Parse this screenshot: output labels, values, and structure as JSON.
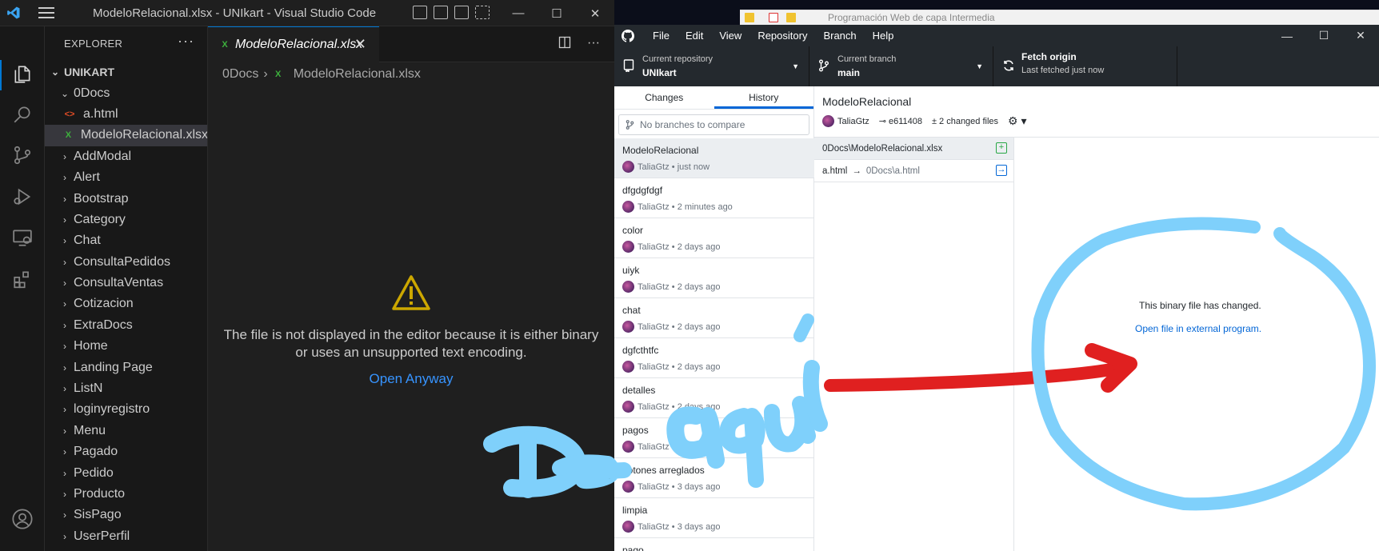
{
  "vscode": {
    "window_title": "ModeloRelacional.xlsx - UNIkart - Visual Studio Code",
    "explorer": {
      "header": "EXPLORER",
      "more": "···",
      "root": "UNIKART",
      "items": [
        {
          "label": "0Docs",
          "type": "folder-open"
        },
        {
          "label": "a.html",
          "type": "html"
        },
        {
          "label": "ModeloRelacional.xlsx",
          "type": "xlsx",
          "selected": true
        },
        {
          "label": "AddModal",
          "type": "folder"
        },
        {
          "label": "Alert",
          "type": "folder"
        },
        {
          "label": "Bootstrap",
          "type": "folder"
        },
        {
          "label": "Category",
          "type": "folder"
        },
        {
          "label": "Chat",
          "type": "folder"
        },
        {
          "label": "ConsultaPedidos",
          "type": "folder"
        },
        {
          "label": "ConsultaVentas",
          "type": "folder"
        },
        {
          "label": "Cotizacion",
          "type": "folder"
        },
        {
          "label": "ExtraDocs",
          "type": "folder"
        },
        {
          "label": "Home",
          "type": "folder"
        },
        {
          "label": "Landing Page",
          "type": "folder"
        },
        {
          "label": "ListN",
          "type": "folder"
        },
        {
          "label": "loginyregistro",
          "type": "folder"
        },
        {
          "label": "Menu",
          "type": "folder"
        },
        {
          "label": "Pagado",
          "type": "folder"
        },
        {
          "label": "Pedido",
          "type": "folder"
        },
        {
          "label": "Producto",
          "type": "folder"
        },
        {
          "label": "SisPago",
          "type": "folder"
        },
        {
          "label": "UserPerfil",
          "type": "folder"
        }
      ]
    },
    "tab": {
      "label": "ModeloRelacional.xlsx",
      "close": "✕"
    },
    "tab_more": "···",
    "breadcrumb": {
      "folder": "0Docs",
      "sep": "›",
      "file": "ModeloRelacional.xlsx"
    },
    "editor": {
      "message": "The file is not displayed in the editor because it is either binary or uses an unsupported text encoding.",
      "open_anyway": "Open Anyway"
    },
    "colors": {
      "accent": "#0078d4",
      "link": "#3794ff",
      "warning": "#cca700"
    }
  },
  "github": {
    "browser_crumb": "Programación Web de capa Intermedia",
    "menu": [
      "File",
      "Edit",
      "View",
      "Repository",
      "Branch",
      "Help"
    ],
    "toolbar": {
      "repo_label": "Current repository",
      "repo_value": "UNIkart",
      "branch_label": "Current branch",
      "branch_value": "main",
      "fetch_label": "Fetch origin",
      "fetch_sub": "Last fetched just now"
    },
    "tabs": {
      "changes": "Changes",
      "history": "History"
    },
    "branch_placeholder": "No branches to compare",
    "commits": [
      {
        "title": "ModeloRelacional",
        "meta": "TaliaGtz • just now",
        "selected": true
      },
      {
        "title": "dfgdgfdgf",
        "meta": "TaliaGtz • 2 minutes ago"
      },
      {
        "title": "color",
        "meta": "TaliaGtz • 2 days ago"
      },
      {
        "title": "uiyk",
        "meta": "TaliaGtz • 2 days ago"
      },
      {
        "title": "chat",
        "meta": "TaliaGtz • 2 days ago"
      },
      {
        "title": "dgfcthtfc",
        "meta": "TaliaGtz • 2 days ago"
      },
      {
        "title": "detalles",
        "meta": "TaliaGtz • 2 days ago"
      },
      {
        "title": "pagos",
        "meta": "TaliaGtz • 2 days ago"
      },
      {
        "title": "botones arreglados",
        "meta": "TaliaGtz • 3 days ago"
      },
      {
        "title": "limpia",
        "meta": "TaliaGtz • 3 days ago"
      },
      {
        "title": "pago",
        "meta": ""
      }
    ],
    "commit_detail": {
      "title": "ModeloRelacional",
      "author": "TaliaGtz",
      "sha": "e611408",
      "changed": "2 changed files"
    },
    "files": [
      {
        "path": "0Docs\\ModeloRelacional.xlsx",
        "status": "added",
        "selected": true
      },
      {
        "from": "a.html",
        "to": "0Docs\\a.html",
        "status": "renamed"
      }
    ],
    "diff": {
      "binary_text": "This binary file has changed.",
      "open_external": "Open file in external program."
    },
    "colors": {
      "toolbar_bg": "#24292e",
      "link": "#0366d6",
      "added": "#28a745",
      "renamed": "#0366d6"
    }
  },
  "annotations": {
    "handwriting": "De aquí",
    "arrow_color": "#e02020",
    "ink_color": "#7fd0fb"
  }
}
